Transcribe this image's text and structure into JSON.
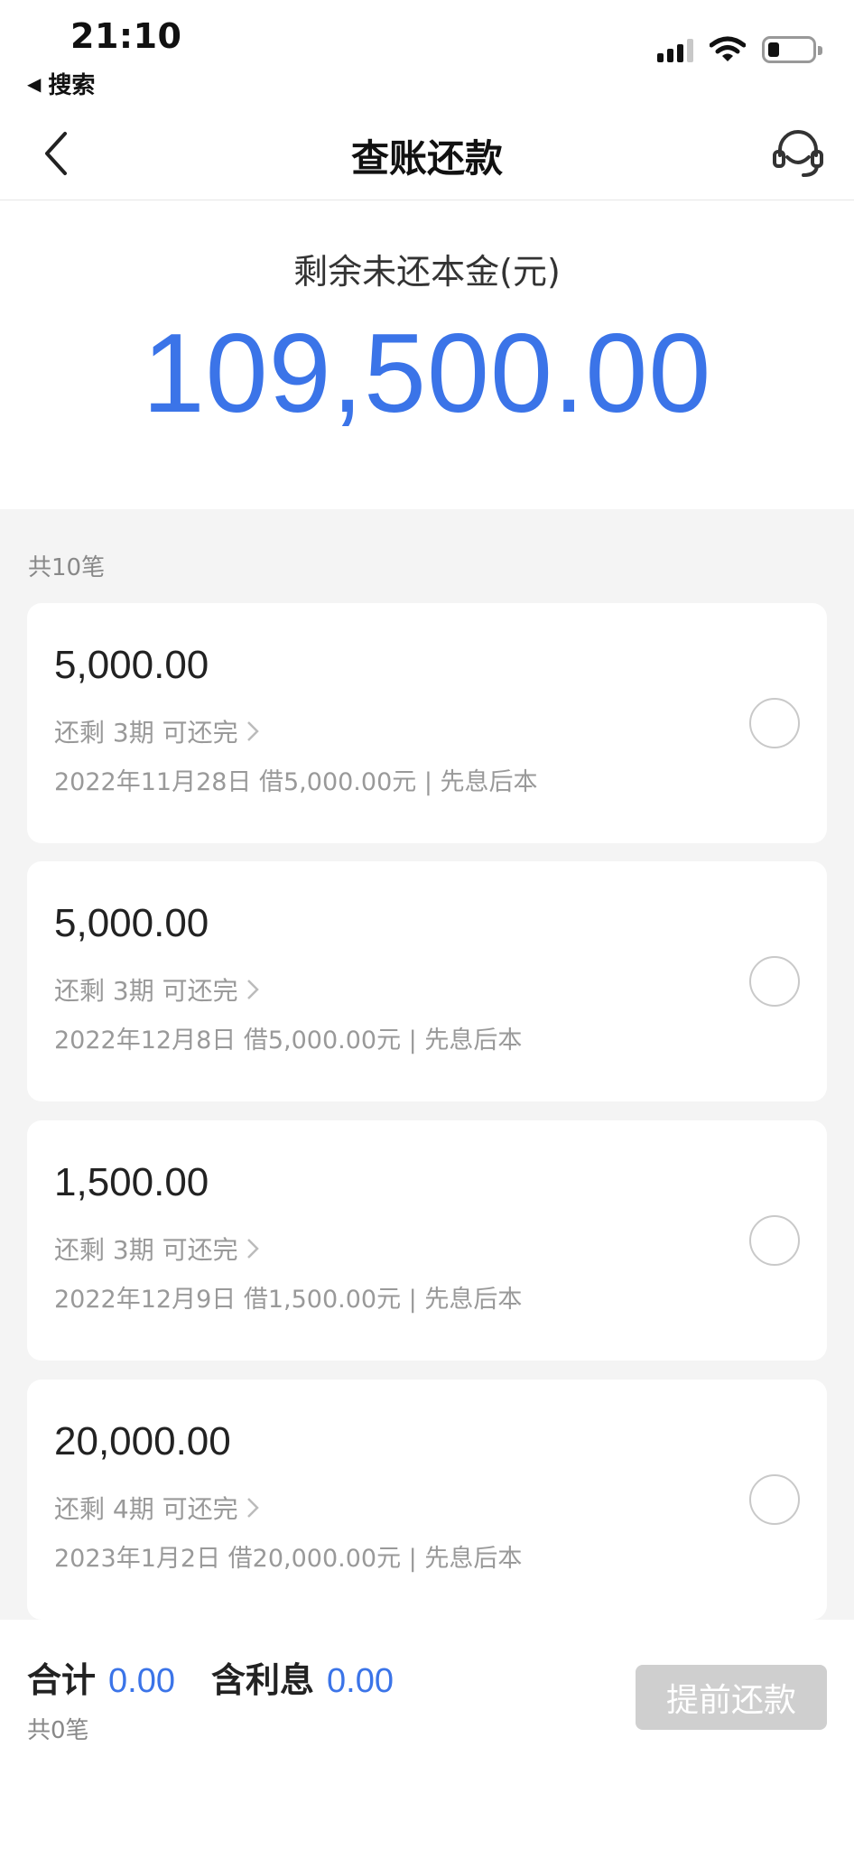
{
  "status_bar": {
    "time": "21:10",
    "back_label": "搜索"
  },
  "nav": {
    "title": "查账还款"
  },
  "summary": {
    "label": "剩余未还本金(元)",
    "amount": "109,500.00"
  },
  "list": {
    "count_label": "共10笔",
    "items": [
      {
        "amount": "5,000.00",
        "remain": "还剩 3期 可还完",
        "detail": "2022年11月28日 借5,000.00元 | 先息后本",
        "selected": false
      },
      {
        "amount": "5,000.00",
        "remain": "还剩 3期 可还完",
        "detail": "2022年12月8日 借5,000.00元 | 先息后本",
        "selected": false
      },
      {
        "amount": "1,500.00",
        "remain": "还剩 3期 可还完",
        "detail": "2022年12月9日 借1,500.00元 | 先息后本",
        "selected": false
      },
      {
        "amount": "20,000.00",
        "remain": "还剩 4期 可还完",
        "detail": "2023年1月2日 借20,000.00元 | 先息后本",
        "selected": false
      }
    ]
  },
  "bottom": {
    "total_label": "合计",
    "total_value": "0.00",
    "interest_label": "含利息",
    "interest_value": "0.00",
    "count_label": "共0笔",
    "button_label": "提前还款"
  },
  "colors": {
    "accent": "#3b74e8",
    "disabled_button": "#cfcfcf",
    "list_background": "#f4f4f4"
  },
  "icons": [
    "back-arrow-icon",
    "customer-service-icon",
    "signal-icon",
    "wifi-icon",
    "battery-icon",
    "chevron-right-icon"
  ]
}
